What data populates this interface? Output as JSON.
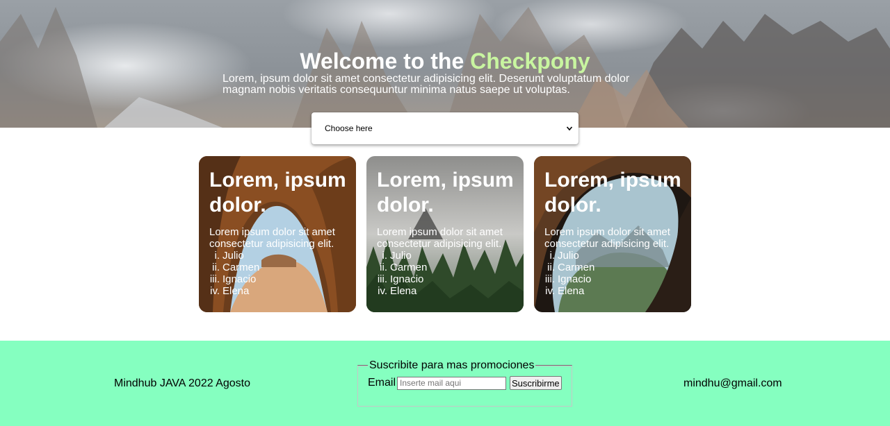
{
  "hero": {
    "title_prefix": "Welcome to the",
    "title_accent": "Checkpony",
    "subtitle": "Lorem, ipsum dolor sit amet consectetur adipisicing elit. Deserunt voluptatum dolor magnam nobis veritatis consequuntur minima natus saepe ut voluptas."
  },
  "select": {
    "value": "Choose here"
  },
  "cards": [
    {
      "title": "Lorem, ipsum dolor.",
      "text": "Lorem ipsum dolor sit amet consectetur adipisicing elit.",
      "items": [
        {
          "num": "i.",
          "name": "Julio"
        },
        {
          "num": "ii.",
          "name": "Carmen"
        },
        {
          "num": "iii.",
          "name": "Ignacio"
        },
        {
          "num": "iv.",
          "name": "Elena"
        }
      ]
    },
    {
      "title": "Lorem, ipsum dolor.",
      "text": "Lorem ipsum dolor sit amet consectetur adipisicing elit.",
      "items": [
        {
          "num": "i.",
          "name": "Julio"
        },
        {
          "num": "ii.",
          "name": "Carmen"
        },
        {
          "num": "iii.",
          "name": "Ignacio"
        },
        {
          "num": "iv.",
          "name": "Elena"
        }
      ]
    },
    {
      "title": "Lorem, ipsum dolor.",
      "text": "Lorem ipsum dolor sit amet consectetur adipisicing elit.",
      "items": [
        {
          "num": "i.",
          "name": "Julio"
        },
        {
          "num": "ii.",
          "name": "Carmen"
        },
        {
          "num": "iii.",
          "name": "Ignacio"
        },
        {
          "num": "iv.",
          "name": "Elena"
        }
      ]
    }
  ],
  "footer": {
    "left_text": "Mindhub JAVA 2022 Agosto",
    "legend": "Suscribite para mas promociones",
    "email_label": "Email",
    "email_placeholder": "Inserte mail aqui",
    "button_label": "Suscribirme",
    "right_text": "mindhu@gmail.com"
  },
  "colors": {
    "accent": "#c8f5a0",
    "footer_bg": "#85ffc0"
  },
  "icons": {
    "select_chevron": "chevron-down-icon"
  }
}
